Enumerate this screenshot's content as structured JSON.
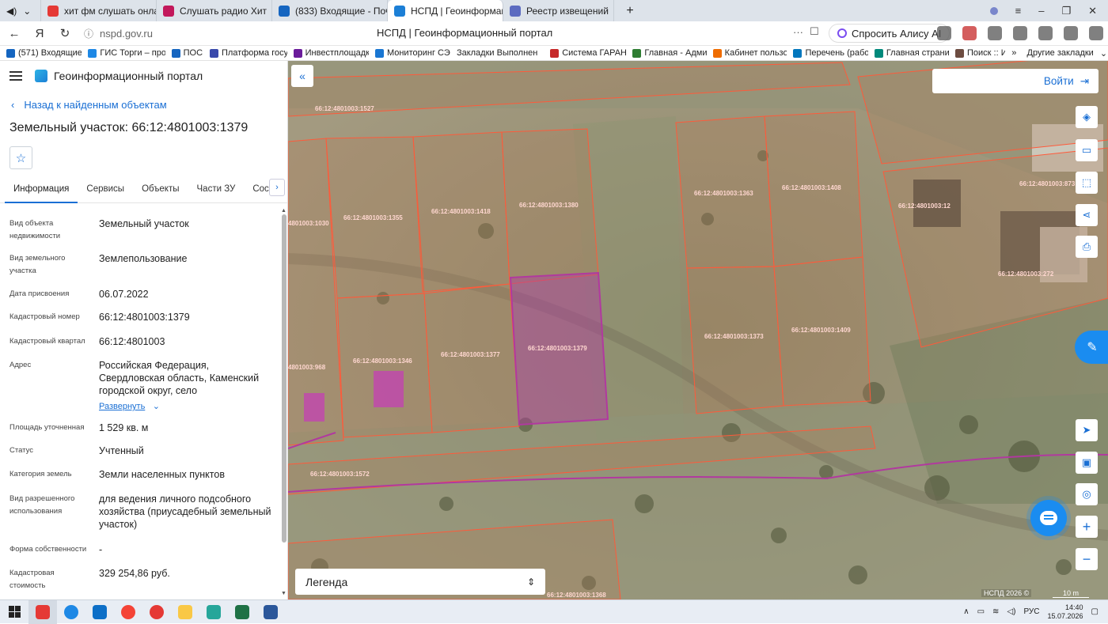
{
  "browser": {
    "tabs": [
      {
        "label": "хит фм слушать онлайн -",
        "color": "#e53935",
        "close": "×"
      },
      {
        "label": "Слушать радио Хит",
        "color": "#c2185b",
        "close": "×"
      },
      {
        "label": "(833) Входящие - Почта М",
        "color": "#1565c0",
        "close": "×"
      },
      {
        "label": "НСПД | Геоинформаци",
        "color": "#1c7fd6",
        "close": "×",
        "active": true
      },
      {
        "label": "Реестр извещений",
        "color": "#5c6bc0",
        "close": ""
      }
    ],
    "new_tab": "+",
    "window_controls": [
      "≡",
      "–",
      "❐",
      "✕"
    ],
    "url": "nspd.gov.ru",
    "page_title": "НСПД | Геоинформационный портал",
    "ask_alice": "Спросить Алису AI",
    "bookmarks": [
      {
        "label": "(571) Входящие -",
        "color": "#1565c0"
      },
      {
        "label": "ГИС Торги – прод",
        "color": "#1e88e5"
      },
      {
        "label": "ПОС",
        "color": "#1565c0"
      },
      {
        "label": "Платформа госуд",
        "color": "#3949ab"
      },
      {
        "label": "Инвестплощадки",
        "color": "#6a1b9a"
      },
      {
        "label": "Мониторинг СЭР",
        "color": "#1976d2"
      },
      {
        "label": "Закладки Выполнен",
        "color": "#ffffff"
      },
      {
        "label": "Система ГАРАНТ",
        "color": "#c62828"
      },
      {
        "label": "Главная - Админ",
        "color": "#2e7d32"
      },
      {
        "label": "Кабинет пользов",
        "color": "#ef6c00"
      },
      {
        "label": "Перечень (рабоч",
        "color": "#0277bd"
      },
      {
        "label": "Главная страниц",
        "color": "#00897b"
      },
      {
        "label": "Поиск :: И",
        "color": "#6d4c41"
      }
    ],
    "bookmarks_more": "»",
    "other_bookmarks": "Другие закладки"
  },
  "panel": {
    "app_title": "Геоинформационный портал",
    "back_link": "Назад к найденным объектам",
    "object_title": "Земельный участок: 66:12:4801003:1379",
    "tabs": [
      "Информация",
      "Сервисы",
      "Объекты",
      "Части ЗУ",
      "Состав"
    ],
    "tab_more": "›",
    "properties": [
      {
        "label": "Вид объекта недвижимости",
        "value": "Земельный участок"
      },
      {
        "label": "Вид земельного участка",
        "value": "Землепользование"
      },
      {
        "label": "Дата присвоения",
        "value": "06.07.2022"
      },
      {
        "label": "Кадастровый номер",
        "value": "66:12:4801003:1379"
      },
      {
        "label": "Кадастровый квартал",
        "value": "66:12:4801003"
      },
      {
        "label": "Адрес",
        "value": "Российская Федерация, Свердловская область, Каменский городской округ, село"
      },
      {
        "label": "Площадь уточненная",
        "value": "1 529 кв. м"
      },
      {
        "label": "Статус",
        "value": "Учтенный"
      },
      {
        "label": "Категория земель",
        "value": "Земли населенных пунктов"
      },
      {
        "label": "Вид разрешенного использования",
        "value": "для ведения личного подсобного хозяйства (приусадебный земельный участок)"
      },
      {
        "label": "Форма собственности",
        "value": "-"
      },
      {
        "label": "Кадастровая стоимость",
        "value": "329 254,86 руб."
      }
    ],
    "expand_link": "Развернуть"
  },
  "map": {
    "login": "Войти",
    "legend": "Легенда",
    "copyright": "НСПД 2026 ©",
    "scale": "10 m",
    "parcel_labels": [
      "66:12:4801003:1527",
      "66:12:4801003:1355",
      "66:12:4801003:1418",
      "66:12:4801003:1380",
      "66:12:4801003:1363",
      "66:12:4801003:1408",
      "66:12:4801003:12",
      "66:12:4801003:873",
      "66:12:4801003:272",
      "66:12:4801003:1346",
      "66:12:4801003:1377",
      "66:12:4801003:1379",
      "66:12:4801003:1373",
      "66:12:4801003:1409",
      "66:12:4801003:1572",
      "66:12:4801003:1368",
      "4801003:1030",
      "4801003:968"
    ]
  },
  "taskbar": {
    "language": "РУС",
    "time": "14:40",
    "date": "15.07.2026"
  },
  "colors": {
    "accent": "#1a6fd4",
    "parcel_border": "#ff5a3a",
    "selected_parcel": "#b1399f"
  }
}
